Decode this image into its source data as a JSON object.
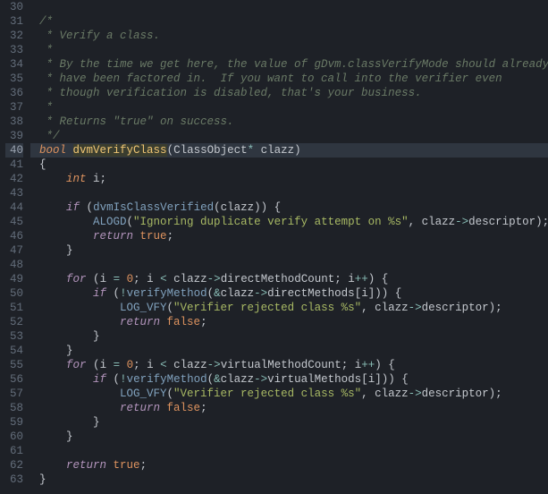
{
  "first_line": 30,
  "active_line": 40,
  "lines": [
    {
      "n": 30,
      "t": [
        [
          "",
          ""
        ]
      ]
    },
    {
      "n": 31,
      "t": [
        [
          "c-comment",
          "/*"
        ]
      ]
    },
    {
      "n": 32,
      "t": [
        [
          "c-comment",
          " * Verify a class."
        ]
      ]
    },
    {
      "n": 33,
      "t": [
        [
          "c-comment",
          " *"
        ]
      ]
    },
    {
      "n": 34,
      "t": [
        [
          "c-comment",
          " * By the time we get here, the value of gDvm.classVerifyMode should already"
        ]
      ]
    },
    {
      "n": 35,
      "t": [
        [
          "c-comment",
          " * have been factored in.  If you want to call into the verifier even"
        ]
      ]
    },
    {
      "n": 36,
      "t": [
        [
          "c-comment",
          " * though verification is disabled, that's your business."
        ]
      ]
    },
    {
      "n": 37,
      "t": [
        [
          "c-comment",
          " *"
        ]
      ]
    },
    {
      "n": 38,
      "t": [
        [
          "c-comment",
          " * Returns \"true\" on success."
        ]
      ]
    },
    {
      "n": 39,
      "t": [
        [
          "c-comment",
          " */"
        ]
      ]
    },
    {
      "n": 40,
      "t": [
        [
          "c-type",
          "bool"
        ],
        [
          "c-plain",
          " "
        ],
        [
          "c-funcdef",
          "dvmVerifyClass"
        ],
        [
          "c-paren",
          "("
        ],
        [
          "c-plain",
          "ClassObject"
        ],
        [
          "c-op",
          "*"
        ],
        [
          "c-plain",
          " clazz"
        ],
        [
          "c-paren",
          ")"
        ]
      ]
    },
    {
      "n": 41,
      "t": [
        [
          "c-paren",
          "{"
        ]
      ]
    },
    {
      "n": 42,
      "t": [
        [
          "c-plain",
          "    "
        ],
        [
          "c-type",
          "int"
        ],
        [
          "c-plain",
          " i;"
        ]
      ]
    },
    {
      "n": 43,
      "t": [
        [
          "",
          ""
        ]
      ]
    },
    {
      "n": 44,
      "t": [
        [
          "c-plain",
          "    "
        ],
        [
          "c-keyword",
          "if"
        ],
        [
          "c-plain",
          " "
        ],
        [
          "c-paren",
          "("
        ],
        [
          "c-func",
          "dvmIsClassVerified"
        ],
        [
          "c-paren",
          "("
        ],
        [
          "c-plain",
          "clazz"
        ],
        [
          "c-paren",
          "))"
        ],
        [
          "c-plain",
          " "
        ],
        [
          "c-paren",
          "{"
        ]
      ]
    },
    {
      "n": 45,
      "t": [
        [
          "c-plain",
          "        "
        ],
        [
          "c-func",
          "ALOGD"
        ],
        [
          "c-paren",
          "("
        ],
        [
          "c-string",
          "\"Ignoring duplicate verify attempt on %s\""
        ],
        [
          "c-plain",
          ", clazz"
        ],
        [
          "c-op",
          "->"
        ],
        [
          "c-plain",
          "descriptor"
        ],
        [
          "c-paren",
          ")"
        ],
        [
          "c-plain",
          ";"
        ]
      ]
    },
    {
      "n": 46,
      "t": [
        [
          "c-plain",
          "        "
        ],
        [
          "c-keyword",
          "return"
        ],
        [
          "c-plain",
          " "
        ],
        [
          "c-const",
          "true"
        ],
        [
          "c-plain",
          ";"
        ]
      ]
    },
    {
      "n": 47,
      "t": [
        [
          "c-plain",
          "    "
        ],
        [
          "c-paren",
          "}"
        ]
      ]
    },
    {
      "n": 48,
      "t": [
        [
          "",
          ""
        ]
      ]
    },
    {
      "n": 49,
      "t": [
        [
          "c-plain",
          "    "
        ],
        [
          "c-keyword",
          "for"
        ],
        [
          "c-plain",
          " "
        ],
        [
          "c-paren",
          "("
        ],
        [
          "c-plain",
          "i "
        ],
        [
          "c-op",
          "="
        ],
        [
          "c-plain",
          " "
        ],
        [
          "c-number",
          "0"
        ],
        [
          "c-plain",
          "; i "
        ],
        [
          "c-op",
          "<"
        ],
        [
          "c-plain",
          " clazz"
        ],
        [
          "c-op",
          "->"
        ],
        [
          "c-plain",
          "directMethodCount; i"
        ],
        [
          "c-op",
          "++"
        ],
        [
          "c-paren",
          ")"
        ],
        [
          "c-plain",
          " "
        ],
        [
          "c-paren",
          "{"
        ]
      ]
    },
    {
      "n": 50,
      "t": [
        [
          "c-plain",
          "        "
        ],
        [
          "c-keyword",
          "if"
        ],
        [
          "c-plain",
          " "
        ],
        [
          "c-paren",
          "("
        ],
        [
          "c-op",
          "!"
        ],
        [
          "c-func",
          "verifyMethod"
        ],
        [
          "c-paren",
          "("
        ],
        [
          "c-op",
          "&"
        ],
        [
          "c-plain",
          "clazz"
        ],
        [
          "c-op",
          "->"
        ],
        [
          "c-plain",
          "directMethods"
        ],
        [
          "c-paren",
          "["
        ],
        [
          "c-plain",
          "i"
        ],
        [
          "c-paren",
          "]))"
        ],
        [
          "c-plain",
          " "
        ],
        [
          "c-paren",
          "{"
        ]
      ]
    },
    {
      "n": 51,
      "t": [
        [
          "c-plain",
          "            "
        ],
        [
          "c-func",
          "LOG_VFY"
        ],
        [
          "c-paren",
          "("
        ],
        [
          "c-string",
          "\"Verifier rejected class %s\""
        ],
        [
          "c-plain",
          ", clazz"
        ],
        [
          "c-op",
          "->"
        ],
        [
          "c-plain",
          "descriptor"
        ],
        [
          "c-paren",
          ")"
        ],
        [
          "c-plain",
          ";"
        ]
      ]
    },
    {
      "n": 52,
      "t": [
        [
          "c-plain",
          "            "
        ],
        [
          "c-keyword",
          "return"
        ],
        [
          "c-plain",
          " "
        ],
        [
          "c-const",
          "false"
        ],
        [
          "c-plain",
          ";"
        ]
      ]
    },
    {
      "n": 53,
      "t": [
        [
          "c-plain",
          "        "
        ],
        [
          "c-paren",
          "}"
        ]
      ]
    },
    {
      "n": 54,
      "t": [
        [
          "c-plain",
          "    "
        ],
        [
          "c-paren",
          "}"
        ]
      ]
    },
    {
      "n": 55,
      "t": [
        [
          "c-plain",
          "    "
        ],
        [
          "c-keyword",
          "for"
        ],
        [
          "c-plain",
          " "
        ],
        [
          "c-paren",
          "("
        ],
        [
          "c-plain",
          "i "
        ],
        [
          "c-op",
          "="
        ],
        [
          "c-plain",
          " "
        ],
        [
          "c-number",
          "0"
        ],
        [
          "c-plain",
          "; i "
        ],
        [
          "c-op",
          "<"
        ],
        [
          "c-plain",
          " clazz"
        ],
        [
          "c-op",
          "->"
        ],
        [
          "c-plain",
          "virtualMethodCount; i"
        ],
        [
          "c-op",
          "++"
        ],
        [
          "c-paren",
          ")"
        ],
        [
          "c-plain",
          " "
        ],
        [
          "c-paren",
          "{"
        ]
      ]
    },
    {
      "n": 56,
      "t": [
        [
          "c-plain",
          "        "
        ],
        [
          "c-keyword",
          "if"
        ],
        [
          "c-plain",
          " "
        ],
        [
          "c-paren",
          "("
        ],
        [
          "c-op",
          "!"
        ],
        [
          "c-func",
          "verifyMethod"
        ],
        [
          "c-paren",
          "("
        ],
        [
          "c-op",
          "&"
        ],
        [
          "c-plain",
          "clazz"
        ],
        [
          "c-op",
          "->"
        ],
        [
          "c-plain",
          "virtualMethods"
        ],
        [
          "c-paren",
          "["
        ],
        [
          "c-plain",
          "i"
        ],
        [
          "c-paren",
          "]))"
        ],
        [
          "c-plain",
          " "
        ],
        [
          "c-paren",
          "{"
        ]
      ]
    },
    {
      "n": 57,
      "t": [
        [
          "c-plain",
          "            "
        ],
        [
          "c-func",
          "LOG_VFY"
        ],
        [
          "c-paren",
          "("
        ],
        [
          "c-string",
          "\"Verifier rejected class %s\""
        ],
        [
          "c-plain",
          ", clazz"
        ],
        [
          "c-op",
          "->"
        ],
        [
          "c-plain",
          "descriptor"
        ],
        [
          "c-paren",
          ")"
        ],
        [
          "c-plain",
          ";"
        ]
      ]
    },
    {
      "n": 58,
      "t": [
        [
          "c-plain",
          "            "
        ],
        [
          "c-keyword",
          "return"
        ],
        [
          "c-plain",
          " "
        ],
        [
          "c-const",
          "false"
        ],
        [
          "c-plain",
          ";"
        ]
      ]
    },
    {
      "n": 59,
      "t": [
        [
          "c-plain",
          "        "
        ],
        [
          "c-paren",
          "}"
        ]
      ]
    },
    {
      "n": 60,
      "t": [
        [
          "c-plain",
          "    "
        ],
        [
          "c-paren",
          "}"
        ]
      ]
    },
    {
      "n": 61,
      "t": [
        [
          "",
          ""
        ]
      ]
    },
    {
      "n": 62,
      "t": [
        [
          "c-plain",
          "    "
        ],
        [
          "c-keyword",
          "return"
        ],
        [
          "c-plain",
          " "
        ],
        [
          "c-const",
          "true"
        ],
        [
          "c-plain",
          ";"
        ]
      ]
    },
    {
      "n": 63,
      "t": [
        [
          "c-paren",
          "}"
        ]
      ]
    }
  ]
}
